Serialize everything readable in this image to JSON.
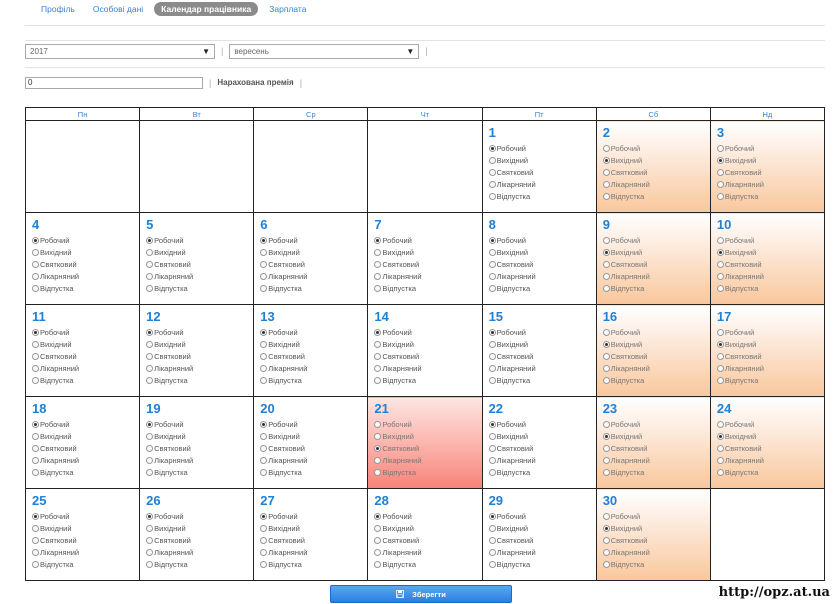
{
  "tabs": [
    {
      "label": "Профіль"
    },
    {
      "label": "Особові дані"
    },
    {
      "label": "Календар працівника"
    },
    {
      "label": "Зарплата"
    }
  ],
  "active_tab": "Календар працівника",
  "filters": {
    "year": "2017",
    "month": "вересень",
    "separator": "|"
  },
  "bonus": {
    "value": "0",
    "label": "Нарахована премія",
    "separator": "|"
  },
  "calendar": {
    "weekday_headers": [
      "Пн",
      "Вт",
      "Ср",
      "Чт",
      "Пт",
      "Сб",
      "Нд"
    ],
    "option_labels": [
      "Робочий",
      "Вихідний",
      "Святковий",
      "Лікарняний",
      "Відпустка"
    ],
    "first_weekday_index": 4,
    "days": [
      {
        "day": "1",
        "selected": "Робочий",
        "style": "normal"
      },
      {
        "day": "2",
        "selected": "Вихідний",
        "style": "weekend"
      },
      {
        "day": "3",
        "selected": "Вихідний",
        "style": "weekend"
      },
      {
        "day": "4",
        "selected": "Робочий",
        "style": "normal"
      },
      {
        "day": "5",
        "selected": "Робочий",
        "style": "normal"
      },
      {
        "day": "6",
        "selected": "Робочий",
        "style": "normal"
      },
      {
        "day": "7",
        "selected": "Робочий",
        "style": "normal"
      },
      {
        "day": "8",
        "selected": "Робочий",
        "style": "normal"
      },
      {
        "day": "9",
        "selected": "Вихідний",
        "style": "weekend"
      },
      {
        "day": "10",
        "selected": "Вихідний",
        "style": "weekend"
      },
      {
        "day": "11",
        "selected": "Робочий",
        "style": "normal"
      },
      {
        "day": "12",
        "selected": "Робочий",
        "style": "normal"
      },
      {
        "day": "13",
        "selected": "Робочий",
        "style": "normal"
      },
      {
        "day": "14",
        "selected": "Робочий",
        "style": "normal"
      },
      {
        "day": "15",
        "selected": "Робочий",
        "style": "normal"
      },
      {
        "day": "16",
        "selected": "Вихідний",
        "style": "weekend"
      },
      {
        "day": "17",
        "selected": "Вихідний",
        "style": "weekend"
      },
      {
        "day": "18",
        "selected": "Робочий",
        "style": "normal"
      },
      {
        "day": "19",
        "selected": "Робочий",
        "style": "normal"
      },
      {
        "day": "20",
        "selected": "Робочий",
        "style": "normal"
      },
      {
        "day": "21",
        "selected": "Святковий",
        "style": "holiday"
      },
      {
        "day": "22",
        "selected": "Робочий",
        "style": "normal"
      },
      {
        "day": "23",
        "selected": "Вихідний",
        "style": "weekend"
      },
      {
        "day": "24",
        "selected": "Вихідний",
        "style": "weekend"
      },
      {
        "day": "25",
        "selected": "Робочий",
        "style": "normal"
      },
      {
        "day": "26",
        "selected": "Робочий",
        "style": "normal"
      },
      {
        "day": "27",
        "selected": "Робочий",
        "style": "normal"
      },
      {
        "day": "28",
        "selected": "Робочий",
        "style": "normal"
      },
      {
        "day": "29",
        "selected": "Робочий",
        "style": "normal"
      },
      {
        "day": "30",
        "selected": "Вихідний",
        "style": "weekend"
      }
    ]
  },
  "save_button": {
    "label": "Зберегти",
    "icon": "floppy-disk-icon"
  },
  "watermark": "http://opz.at.ua",
  "colors": {
    "link": "#3a7fcf",
    "day_number": "#1f80d6",
    "active_tab_bg": "#8b8b8b",
    "weekend_tint": "#f9c79c",
    "holiday_tint": "#f7837a",
    "button": "#2a7ede"
  }
}
